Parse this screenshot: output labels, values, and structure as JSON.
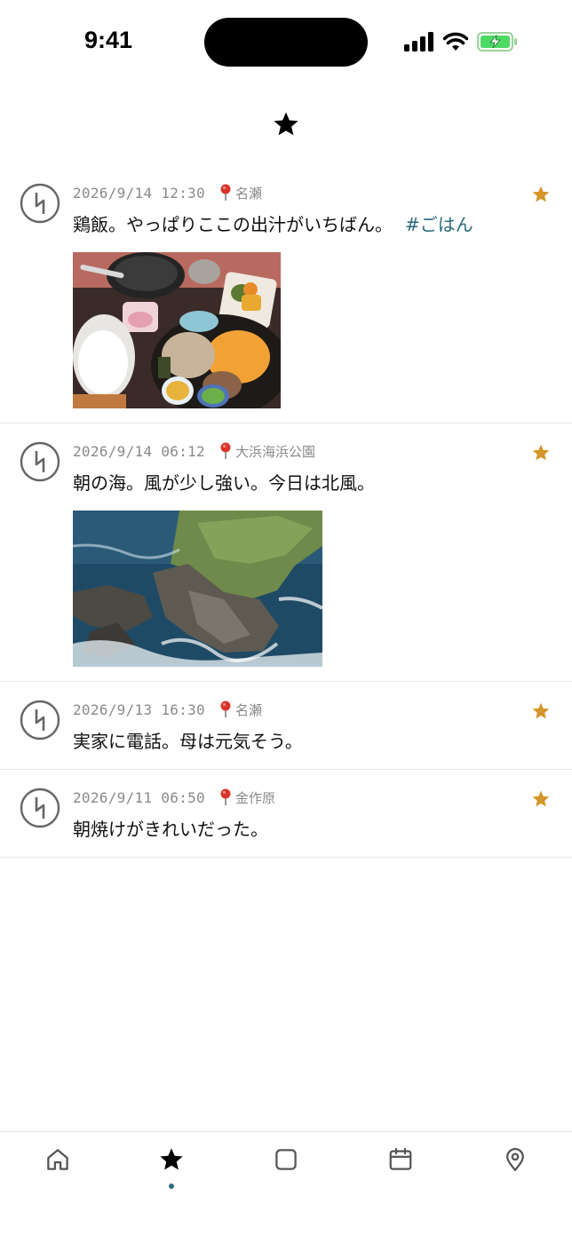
{
  "status_bar": {
    "time": "9:41"
  },
  "colors": {
    "accent": "#2a6a7a",
    "favorite_star": "#d4952a",
    "pin": "#d9342b",
    "meta_gray": "#8a8a8a"
  },
  "icons": {
    "header": "star-icon",
    "avatar": "avatar-rune-icon",
    "location": "pin-icon",
    "favorite": "star-icon"
  },
  "posts": [
    {
      "timestamp": "2026/9/14 12:30",
      "location": "名瀬",
      "text": "鶏飯。やっぱりここの出汁がいちばん。",
      "hashtag": "#ごはん",
      "photo": "food-photo",
      "favorited": true
    },
    {
      "timestamp": "2026/9/14 06:12",
      "location": "大浜海浜公園",
      "text": "朝の海。風が少し強い。今日は北風。",
      "hashtag": "",
      "photo": "coast-photo",
      "favorited": true
    },
    {
      "timestamp": "2026/9/13 16:30",
      "location": "名瀬",
      "text": "実家に電話。母は元気そう。",
      "hashtag": "",
      "photo": "",
      "favorited": true
    },
    {
      "timestamp": "2026/9/11 06:50",
      "location": "金作原",
      "text": "朝焼けがきれいだった。",
      "hashtag": "",
      "photo": "",
      "favorited": true
    }
  ],
  "tabbar": {
    "tabs": [
      {
        "icon": "home-icon",
        "active": false
      },
      {
        "icon": "star-icon",
        "active": true
      },
      {
        "icon": "square-icon",
        "active": false
      },
      {
        "icon": "calendar-icon",
        "active": false
      },
      {
        "icon": "map-pin-icon",
        "active": false
      }
    ]
  }
}
